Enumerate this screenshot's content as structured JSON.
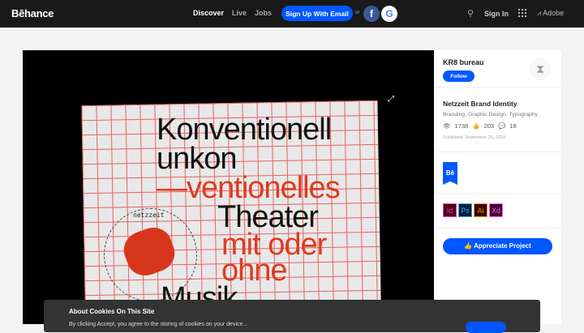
{
  "header": {
    "logo": "Bēhance",
    "nav": [
      "Discover",
      "Live",
      "Jobs"
    ],
    "signup": "Sign Up With Email",
    "or": "or",
    "facebook": "f",
    "google": "G",
    "signin": "Sign In",
    "adobe": "Adobe"
  },
  "artwork": {
    "lines": [
      "Konventionell",
      "unkon",
      "—ventionelles",
      "Theater",
      "mit oder",
      "ohne",
      "Musik"
    ],
    "circle_text": "netzzeit"
  },
  "sidebar": {
    "owner": "KR8 bureau",
    "follow": "Follow",
    "project_title": "Netzzeit Brand Identity",
    "fields": "Branding, Graphic Design, Typography",
    "views": "1738",
    "appreciations": "203",
    "comments": "18",
    "published": "Published: September 25, 2018",
    "badge": "Bē",
    "tools": [
      "Id",
      "Ps",
      "Ai",
      "Xd"
    ],
    "appreciate": "Appreciate Project"
  },
  "cookie": {
    "title": "About Cookies On This Site",
    "body": "By clicking Accept, you agree to the storing of cookies on your device..."
  },
  "colors": {
    "accent": "#0057ff",
    "red": "#e03a1e"
  }
}
